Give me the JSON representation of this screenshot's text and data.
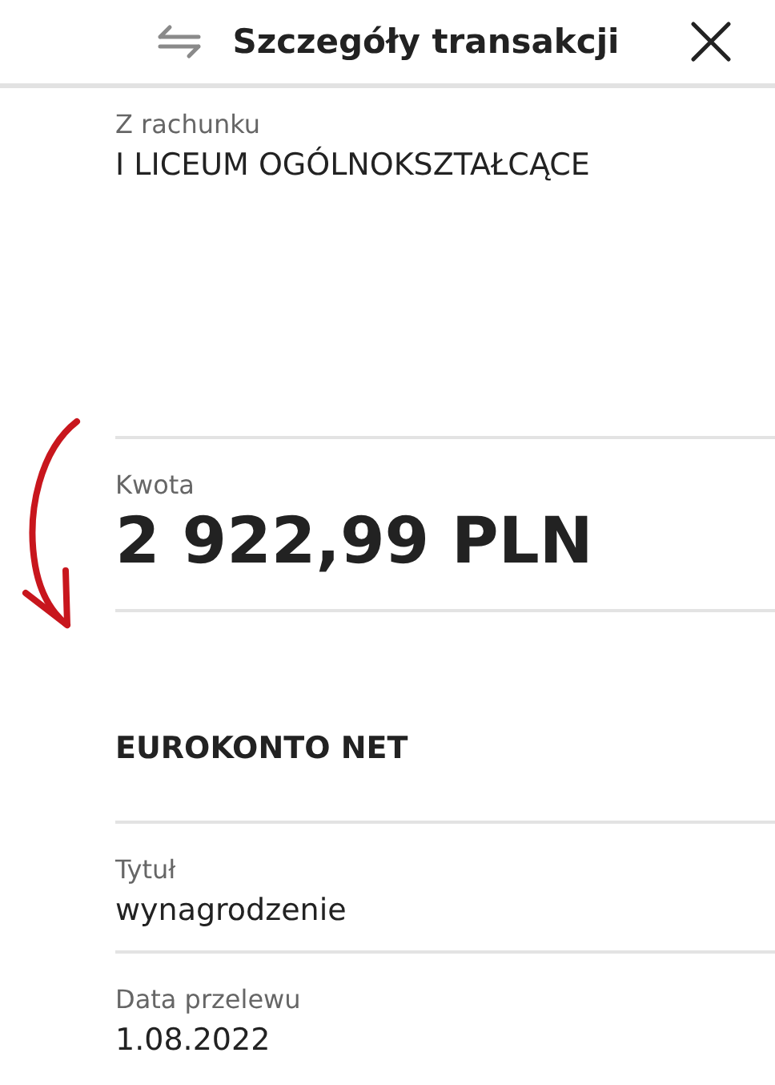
{
  "header": {
    "title": "Szczegóły transakcji"
  },
  "sections": [
    {
      "kind": "field",
      "label": "Z rachunku",
      "value": "I LICEUM OGÓLNOKSZTAŁCĄCE"
    },
    {
      "kind": "amount",
      "label": "Kwota",
      "value": "2 922,99 PLN"
    },
    {
      "kind": "account",
      "value": "EUROKONTO NET"
    },
    {
      "kind": "field",
      "label": "Tytuł",
      "value": "wynagrodzenie"
    },
    {
      "kind": "field",
      "label": "Data przelewu",
      "value": "1.08.2022"
    }
  ]
}
